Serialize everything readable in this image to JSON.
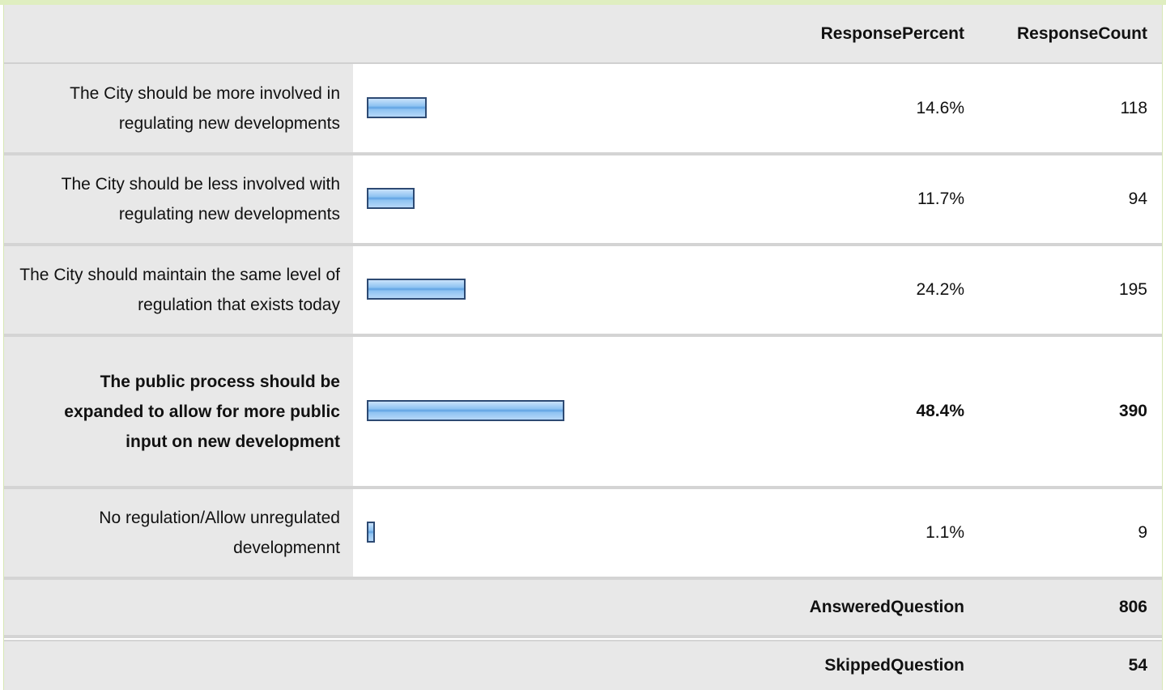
{
  "header": {
    "percent_label": "ResponsePercent",
    "count_label": "ResponseCount"
  },
  "rows": [
    {
      "label": "The City should be more involved in regulating new developments",
      "percent": "14.6%",
      "count": "118",
      "value": 14.6,
      "bold": false
    },
    {
      "label": "The City should be less involved with regulating new developments",
      "percent": "11.7%",
      "count": "94",
      "value": 11.7,
      "bold": false
    },
    {
      "label": "The City should maintain the same level of regulation that exists today",
      "percent": "24.2%",
      "count": "195",
      "value": 24.2,
      "bold": false
    },
    {
      "label": "The public process should be expanded to allow for more public input on new development",
      "percent": "48.4%",
      "count": "390",
      "value": 48.4,
      "bold": true
    },
    {
      "label": "No regulation/Allow unregulated developmennt",
      "percent": "1.1%",
      "count": "9",
      "value": 1.1,
      "bold": false
    }
  ],
  "summary": {
    "answered_label": "AnsweredQuestion",
    "answered_value": "806",
    "skipped_label": "SkippedQuestion",
    "skipped_value": "54"
  },
  "colors": {
    "bar_fill": "#8ec3f2",
    "bar_border": "#2d4a73",
    "label_bg": "#e8e8e8",
    "frame_accent": "#dfeec0"
  },
  "chart_data": {
    "type": "bar",
    "categories": [
      "The City should be more involved in regulating new developments",
      "The City should be less involved with regulating new developments",
      "The City should maintain the same level of regulation that exists today",
      "The public process should be expanded to allow for more public input on new development",
      "No regulation/Allow unregulated developmennt"
    ],
    "series": [
      {
        "name": "ResponsePercent",
        "values": [
          14.6,
          11.7,
          24.2,
          48.4,
          1.1
        ]
      },
      {
        "name": "ResponseCount",
        "values": [
          118,
          94,
          195,
          390,
          9
        ]
      }
    ],
    "orientation": "horizontal",
    "xlim": [
      0,
      100
    ]
  }
}
